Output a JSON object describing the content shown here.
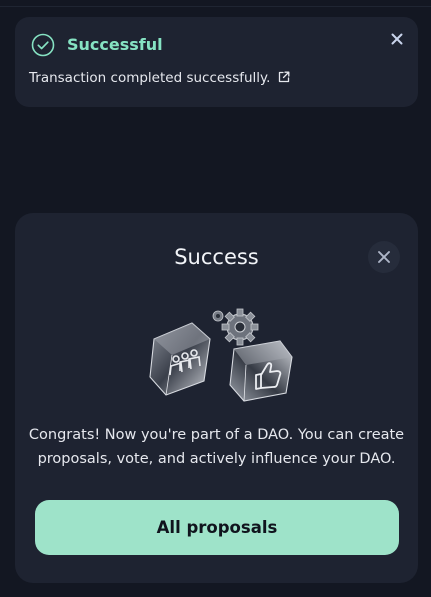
{
  "toast": {
    "icon": "check-circle-icon",
    "title": "Successful",
    "message": "Transaction completed successfully.",
    "close_icon": "close-icon",
    "link_icon": "external-link-icon"
  },
  "modal": {
    "title": "Success",
    "close_icon": "close-icon",
    "illustration": "dao-cubes-illustration",
    "message": "Congrats! Now you're part of a DAO. You can create proposals, vote, and actively influence your DAO.",
    "button_label": "All proposals"
  },
  "colors": {
    "background": "#131722",
    "card": "#1e2331",
    "accent": "#86e3c3",
    "button": "#9ee3c9"
  }
}
